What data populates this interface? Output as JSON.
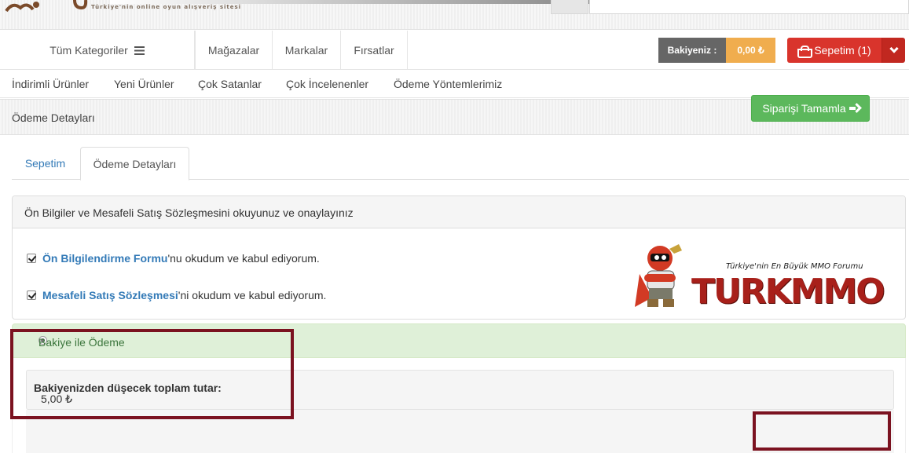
{
  "header": {
    "tagline": "Türkiye'nin online oyun alışveriş sitesi"
  },
  "nav": {
    "categories_label": "Tüm Kategoriler",
    "links": [
      "Mağazalar",
      "Markalar",
      "Fırsatlar"
    ],
    "balance_label": "Bakiyeniz :",
    "balance_value": "0,00 ₺",
    "cart_label": "Sepetim (1)"
  },
  "subnav": {
    "links": [
      "İndirimli Ürünler",
      "Yeni Ürünler",
      "Çok Satanlar",
      "Çok İncelenenler",
      "Ödeme Yöntemlerimiz"
    ]
  },
  "page": {
    "title": "Ödeme Detayları"
  },
  "tabs": [
    "Sepetim",
    "Ödeme Detayları"
  ],
  "agreement": {
    "heading": "Ön Bilgiler ve Mesafeli Satış Sözleşmesini okuyunuz ve onaylayınız",
    "items": [
      {
        "link": "Ön Bilgilendirme Formu",
        "suffix": "'nu okudum ve kabul ediyorum.",
        "checked": true
      },
      {
        "link": "Mesafeli Satış Sözleşmesi",
        "suffix": "'ni okudum ve kabul ediyorum.",
        "checked": true
      }
    ]
  },
  "brand_logo": {
    "slogan": "Türkiye'nin En Büyük MMO Forumu",
    "name": "TURKMMO"
  },
  "payment": {
    "method_label": "Bakiye ile Ödeme",
    "total_label": "Bakiyenizden düşecek toplam tutar:",
    "total_value": "5,00 ₺",
    "submit_label": "Siparişi Tamamla"
  },
  "colors": {
    "cart": "#d9342c",
    "balance": "#f0ad4e",
    "submit": "#5cb85c",
    "highlight": "#7b1220",
    "link": "#337ab7"
  }
}
